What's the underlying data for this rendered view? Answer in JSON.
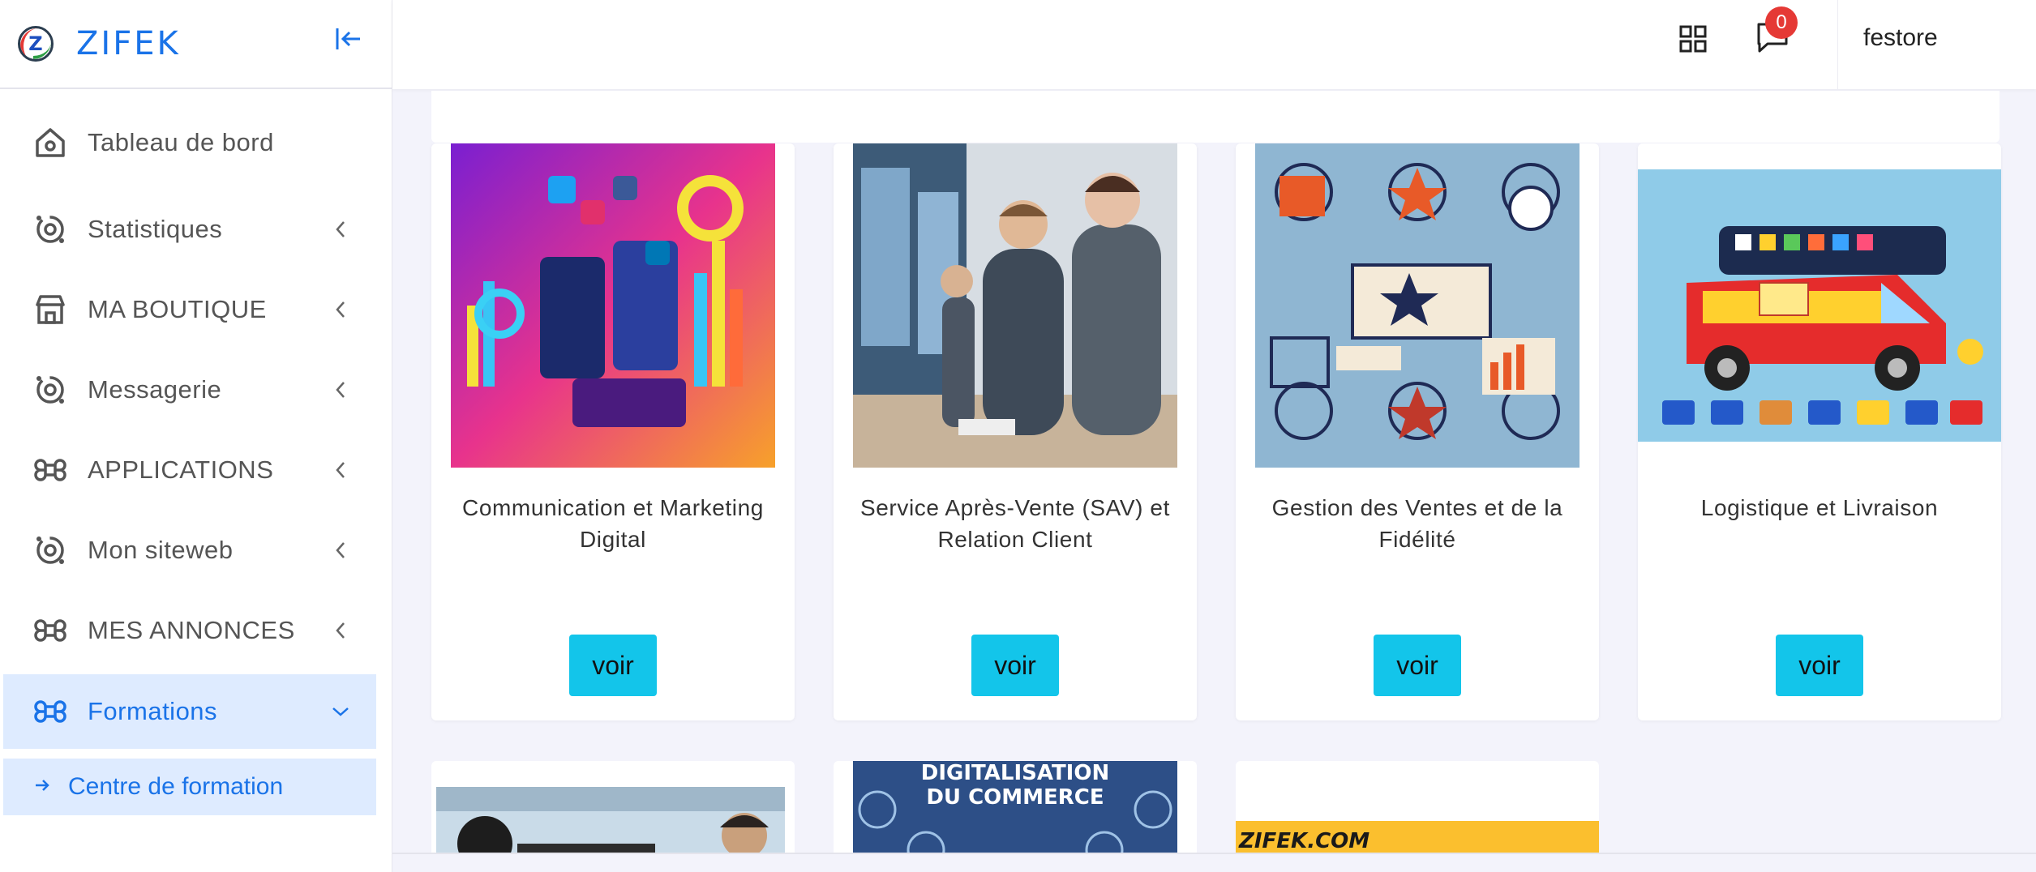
{
  "brand": {
    "name": "ZIFEK",
    "logo_letter": "Z"
  },
  "sidebar": {
    "items": [
      {
        "label": "Tableau de bord",
        "icon": "home-icon"
      },
      {
        "label": "Statistiques",
        "icon": "chart-icon"
      },
      {
        "label": "MA BOUTIQUE",
        "icon": "store-icon"
      },
      {
        "label": "Messagerie",
        "icon": "chat-icon"
      },
      {
        "label": "APPLICATIONS",
        "icon": "command-icon"
      },
      {
        "label": "Mon siteweb",
        "icon": "web-icon"
      },
      {
        "label": "MES ANNONCES",
        "icon": "command-icon"
      },
      {
        "label": "Formations",
        "icon": "command-icon",
        "active": true
      }
    ],
    "submenu": {
      "label": "Centre de formation"
    }
  },
  "topbar": {
    "notifications_count": "0",
    "username": "festore"
  },
  "cards": [
    {
      "title": "Communication et Marketing Digital",
      "button": "voir"
    },
    {
      "title": "Service Après-Vente (SAV) et Relation Client",
      "button": "voir"
    },
    {
      "title": "Gestion des Ventes et de la Fidélité",
      "button": "voir"
    },
    {
      "title": "Logistique et Livraison",
      "button": "voir"
    }
  ],
  "second_row": [
    {
      "image_text": ""
    },
    {
      "image_text": "DIGITALISATION DU COMMERCE"
    },
    {
      "image_text": "ZIFEK.COM"
    }
  ],
  "colors": {
    "accent": "#1a73e8",
    "active_bg": "#deebff",
    "button": "#13c5ea",
    "badge": "#e53935"
  }
}
